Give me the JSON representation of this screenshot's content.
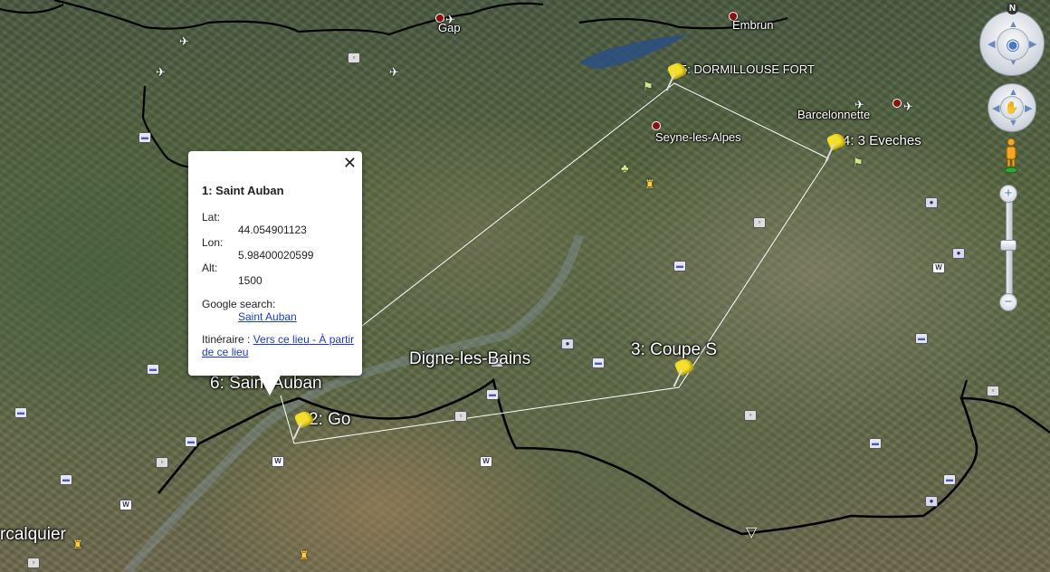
{
  "map": {
    "place_labels": {
      "gap": "Gap",
      "embrun": "Embrun",
      "barcelonnette": "Barcelonnette",
      "seyne": "Seyne-les-Alpes",
      "digne": "Digne-les-Bains",
      "forcalquier": "rcalquier"
    },
    "placemarks": {
      "p1_6": "6: Saint Auban",
      "p2": "2: Go",
      "p3": "3: Coupe S",
      "p4": "4: 3 Eveches",
      "p5": "5: DORMILLOUSE FORT"
    },
    "compass_north": "N"
  },
  "balloon": {
    "close": "✕",
    "title": "1: Saint Auban",
    "lat_label": "Lat:",
    "lat_value": "44.054901123",
    "lon_label": "Lon:",
    "lon_value": "5.98400020599",
    "alt_label": "Alt:",
    "alt_value": "1500",
    "google_label": "Google search:",
    "google_link": "Saint Auban",
    "itinerary_label": "Itinéraire : ",
    "to_link": "Vers ce lieu",
    "sep": " - ",
    "from_link": "À partir de ce lieu"
  },
  "colors": {
    "pin": "#f4e02a",
    "route": "#000000",
    "link": "#1a3ac8"
  }
}
